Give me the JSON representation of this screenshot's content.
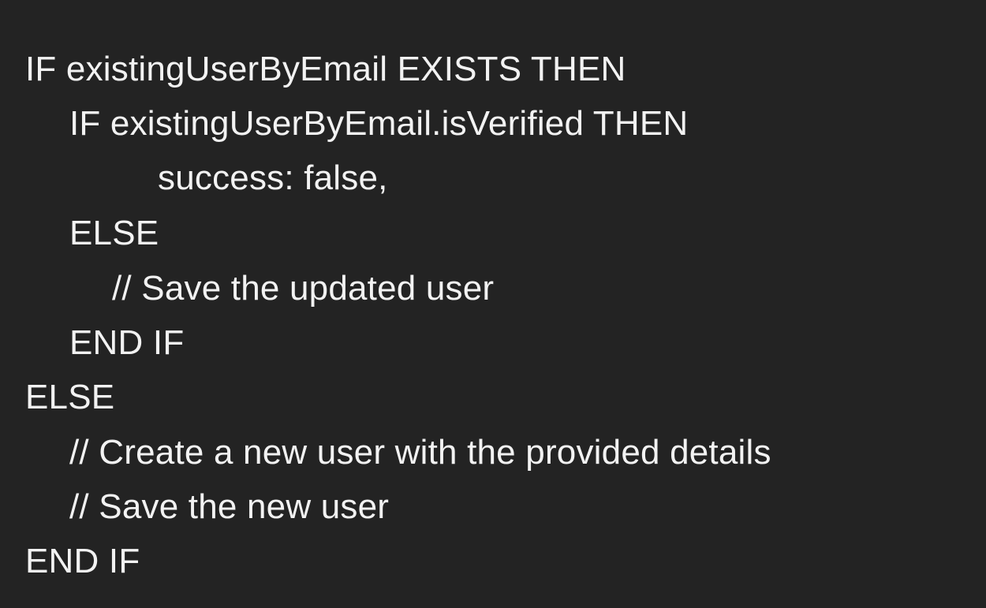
{
  "code": {
    "lines": [
      "IF existingUserByEmail EXISTS THEN",
      "IF existingUserByEmail.isVerified THEN",
      "success: false,",
      "ELSE",
      "// Save the updated user",
      "END IF",
      "ELSE",
      "// Create a new user with the provided details",
      "// Save the new user",
      "END IF"
    ]
  },
  "colors": {
    "background": "#232323",
    "text": "#f2f2f2"
  }
}
